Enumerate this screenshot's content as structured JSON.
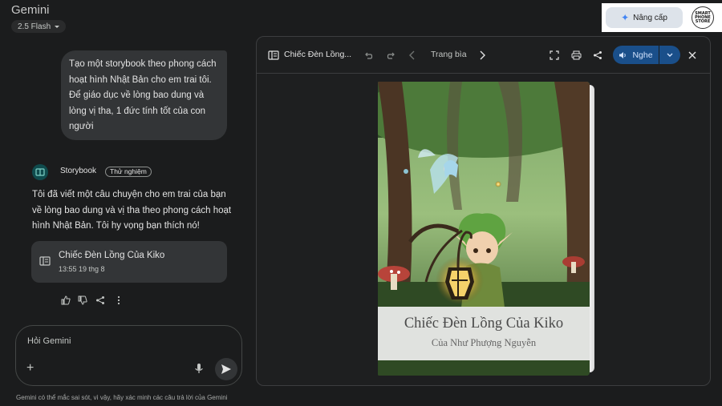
{
  "header": {
    "app_title": "Gemini",
    "model_label": "2.5 Flash",
    "upgrade_label": "Nâng cấp",
    "brand_logo_lines": [
      "SMART",
      "PHONE",
      "STORE"
    ]
  },
  "chat": {
    "user_message": "Tạo một storybook theo phong cách hoạt hình Nhật Bản cho em trai tôi. Để giáo dục về lòng bao dung và lòng vị tha, 1 đức tính tốt của con người",
    "assistant": {
      "name": "Storybook",
      "badge": "Thử nghiệm",
      "reply": "Tôi đã viết một câu chuyện cho em trai của bạn về lòng bao dung và vị tha theo phong cách hoạt hình Nhật Bản. Tôi hy vọng bạn thích nó!",
      "card": {
        "title": "Chiếc Đèn Lồng Của Kiko",
        "date": "13:55 19 thg 8"
      }
    }
  },
  "input": {
    "placeholder": "Hỏi Gemini"
  },
  "disclaimer": "Gemini có thể mắc sai sót, vì vậy, hãy xác minh các câu trả lời của Gemini",
  "panel": {
    "title": "Chiếc Đèn Lồng...",
    "page_label": "Trang bìa",
    "listen_label": "Nghe",
    "book": {
      "title": "Chiếc Đèn Lồng Của Kiko",
      "author": "Của Như Phượng Nguyễn"
    }
  },
  "colors": {
    "background": "#1b1c1d",
    "surface": "#333537",
    "listen_button": "#1a4f8a",
    "forest": "#3f6b34"
  },
  "icons": [
    "chevron-down-icon",
    "sparkle-icon",
    "storybook-icon",
    "book-icon",
    "thumb-up-icon",
    "thumb-down-icon",
    "share-icon",
    "more-vert-icon",
    "plus-icon",
    "mic-icon",
    "send-icon",
    "undo-icon",
    "redo-icon",
    "chevron-left-icon",
    "chevron-right-icon",
    "fullscreen-icon",
    "print-icon",
    "volume-icon",
    "close-icon"
  ]
}
